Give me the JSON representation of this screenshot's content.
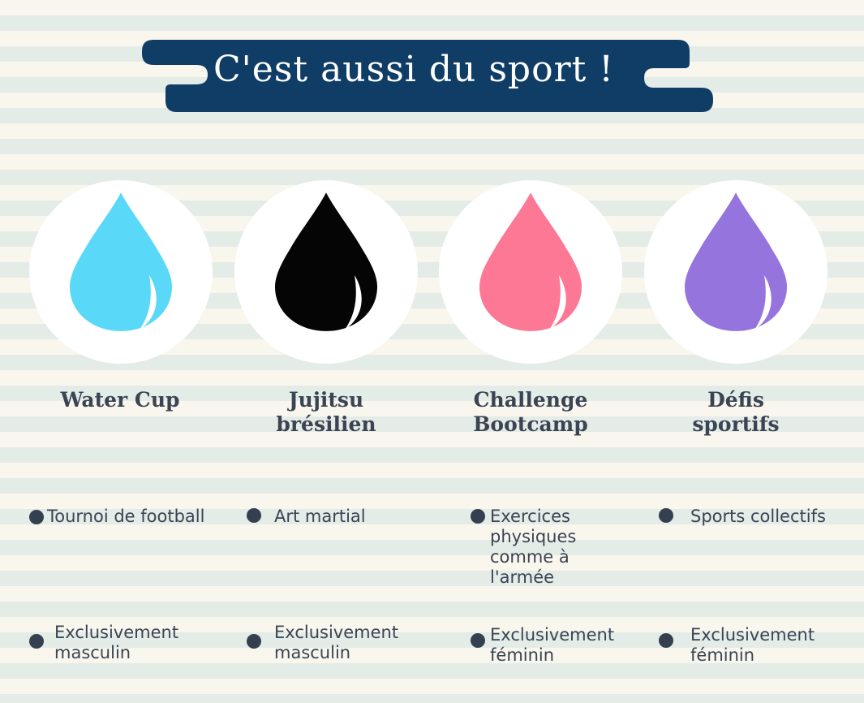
{
  "header": {
    "title": "C'est aussi du sport !"
  },
  "colors": {
    "banner": "#0f3d66",
    "text": "#3a4452",
    "bullet": "#344050"
  },
  "sports": [
    {
      "title": "Water Cup",
      "drop_color": "#5ad8f7",
      "items": [
        "Tournoi de football",
        "Exclusivement\nmasculin"
      ]
    },
    {
      "title": "Jujitsu\nbrésilien",
      "drop_color": "#050505",
      "items": [
        "Art martial",
        "Exclusivement\nmasculin"
      ]
    },
    {
      "title": "Challenge\nBootcamp",
      "drop_color": "#fc7895",
      "items": [
        "Exercices\nphysiques\ncomme à\nl'armée",
        "Exclusivement\nféminin"
      ]
    },
    {
      "title": "Défis\nsportifs",
      "drop_color": "#9575dd",
      "items": [
        "Sports collectifs",
        "Exclusivement\nféminin"
      ]
    }
  ]
}
